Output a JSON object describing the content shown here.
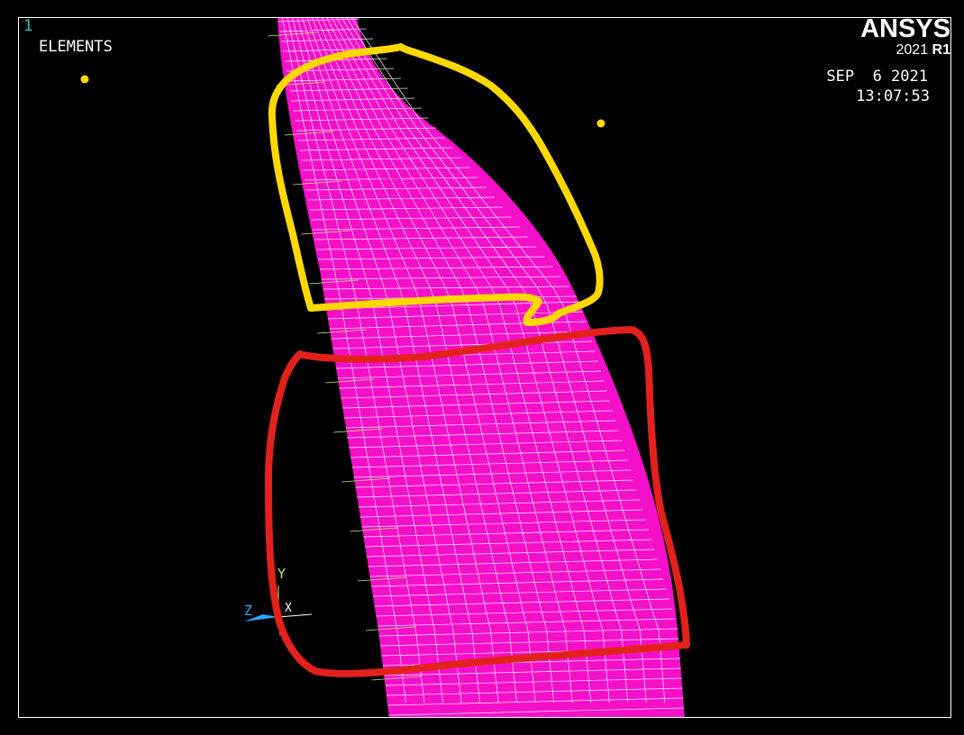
{
  "window_number": "1",
  "plot_title": "ELEMENTS",
  "logo": {
    "name": "ANSYS",
    "version_year": "2021",
    "version_release": "R1"
  },
  "date": "SEP  6 2021",
  "time": "13:07:53",
  "triad": {
    "y_label": "Y",
    "z_label": "Z",
    "x_label": "X"
  },
  "colors": {
    "background": "#000000",
    "mesh_fill": "#f410c8",
    "mesh_lines": "#ffffff",
    "yellow_markup": "#ffd800",
    "red_markup": "#e3211c",
    "window_number": "#3bc0c0",
    "triad_z": "#2aa8ff",
    "triad_y": "#c8e87a"
  }
}
